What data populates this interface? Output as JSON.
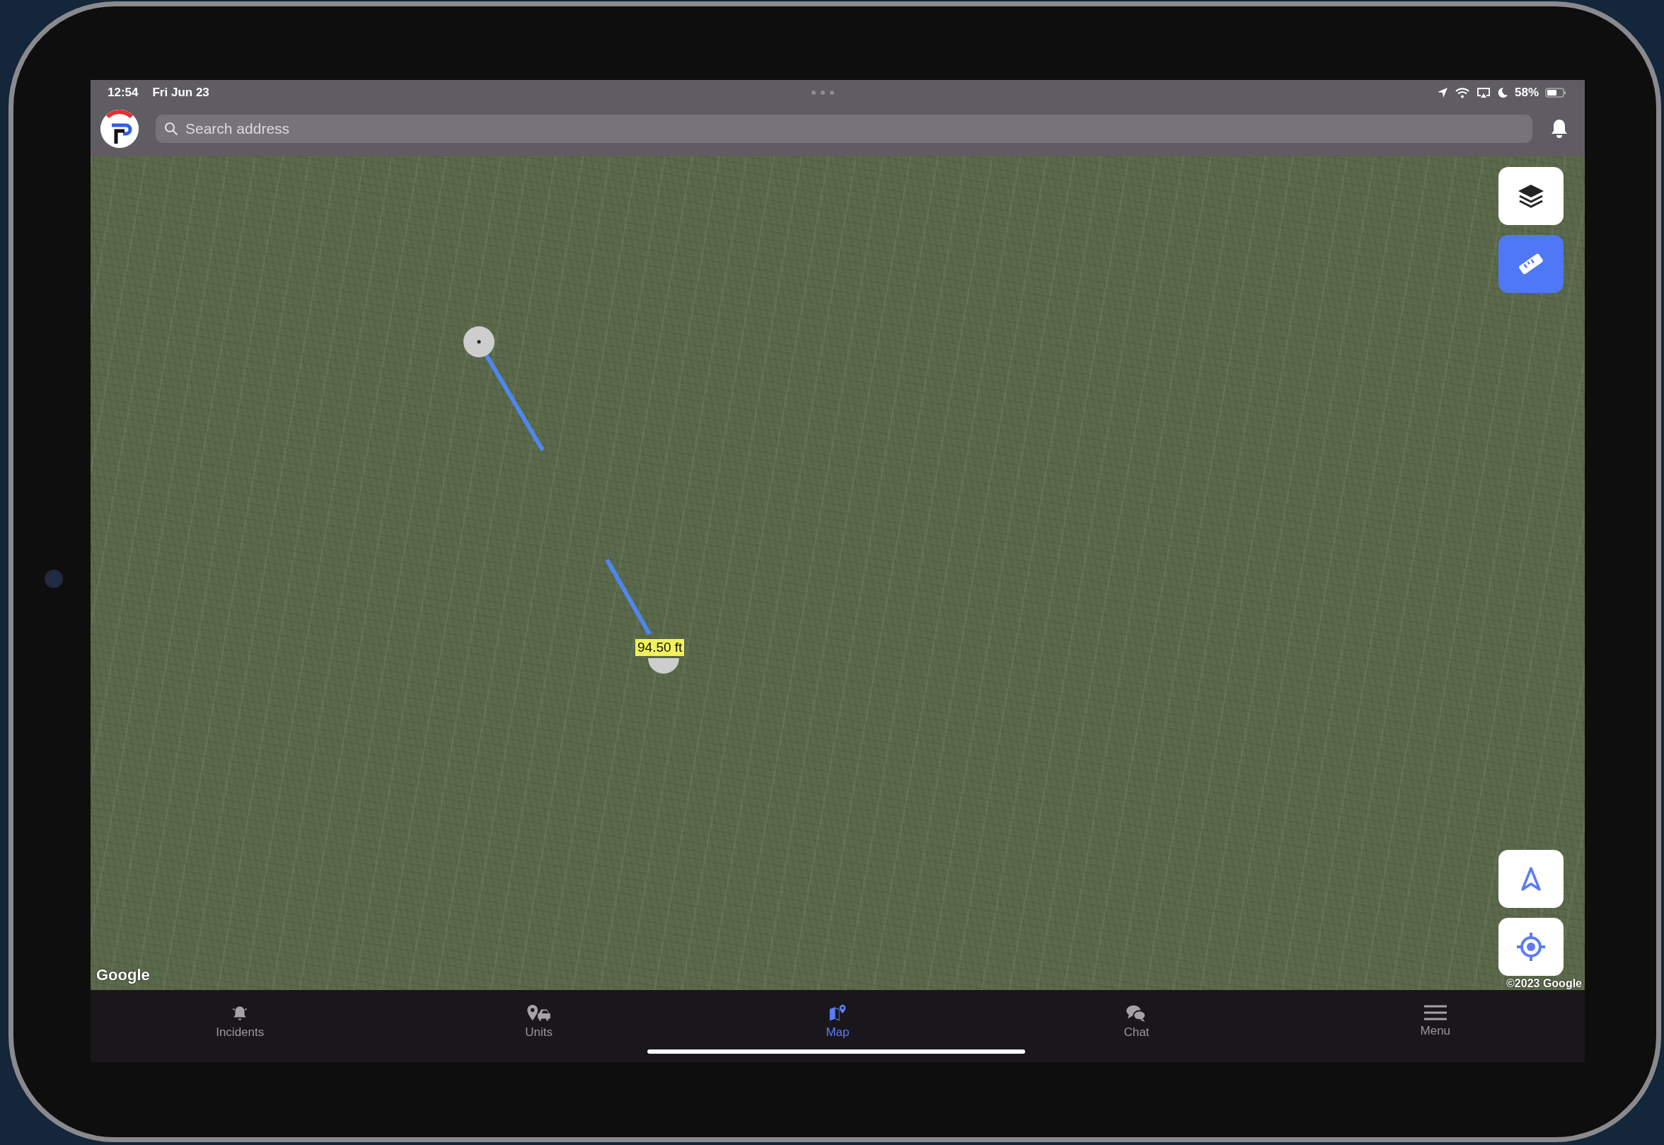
{
  "status_bar": {
    "time": "12:54",
    "date": "Fri Jun 23",
    "battery": "58%"
  },
  "search": {
    "placeholder": "Search address"
  },
  "map": {
    "tools": [
      {
        "active": false
      },
      {
        "active": true
      }
    ],
    "measurement": {
      "label": "94.50 ft"
    },
    "logo": "Google",
    "copyright": "©2023 Google"
  },
  "tabs": [
    {
      "label": "Incidents",
      "selected": false
    },
    {
      "label": "Units",
      "selected": false
    },
    {
      "label": "Map",
      "selected": true
    },
    {
      "label": "Chat",
      "selected": false
    },
    {
      "label": "Menu",
      "selected": false
    }
  ]
}
